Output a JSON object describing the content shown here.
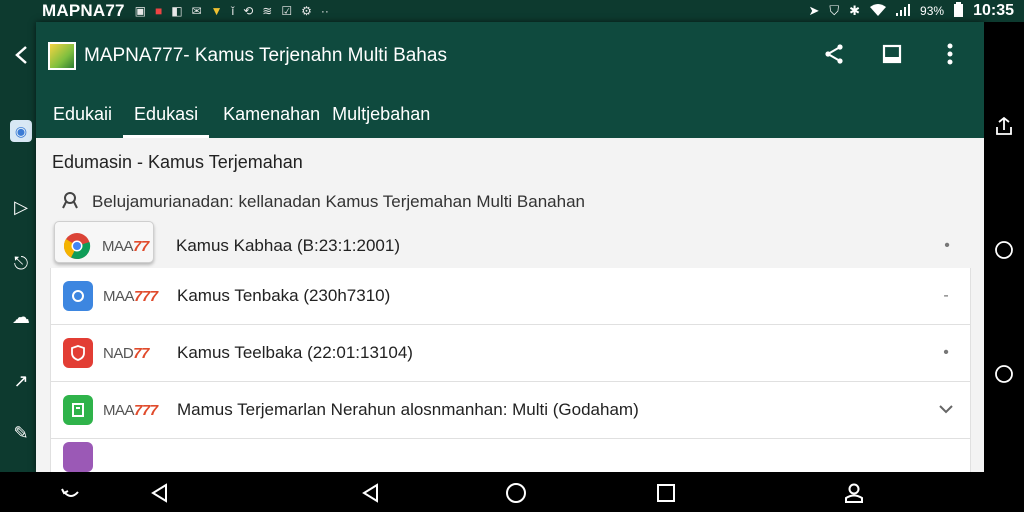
{
  "status_bar": {
    "title": "MAPNA77",
    "battery_text": "93%",
    "time": "10:35"
  },
  "app": {
    "title": "MAPNA777- Kamus Terjenahn Multi Bahas",
    "tabs": [
      {
        "label": "Edukaii",
        "active": false
      },
      {
        "label": "Edukasi",
        "active": true
      },
      {
        "label": "Kamenahan",
        "active": false
      },
      {
        "label": "Multjebahan",
        "active": false
      }
    ],
    "section_title": "Edumasin - Kamus Terjemahan",
    "subtitle": "Belujamurianadan: kellanadan Kamus Terjemahan Multi Banahan",
    "items": [
      {
        "brand_prefix": "MAA",
        "brand_suffix": "77",
        "text": "Kamus Kabhaa (B:23:1:2001)",
        "icon_color": "#f2f2f2",
        "icon": "chrome-icon"
      },
      {
        "brand_prefix": "MAA",
        "brand_suffix": "777",
        "text": "Kamus Tenbaka  (230h7310)",
        "icon_color": "#3d86e0",
        "icon": "circle-icon"
      },
      {
        "brand_prefix": "NAD",
        "brand_suffix": "77",
        "text": "Kamus Teelbaka  (22:01:13104)",
        "icon_color": "#e23d34",
        "icon": "shield-icon"
      },
      {
        "brand_prefix": "MAA",
        "brand_suffix": "777",
        "text": "Mamus Terjemarlan  Nerahun alosnmanhan: Multi (Godaham)",
        "icon_color": "#2fb34a",
        "icon": "square-icon"
      }
    ]
  },
  "colors": {
    "toolbar": "#0f4a3e",
    "status_bar": "#0d3a2f",
    "accent_brand": "#e04b2c"
  }
}
